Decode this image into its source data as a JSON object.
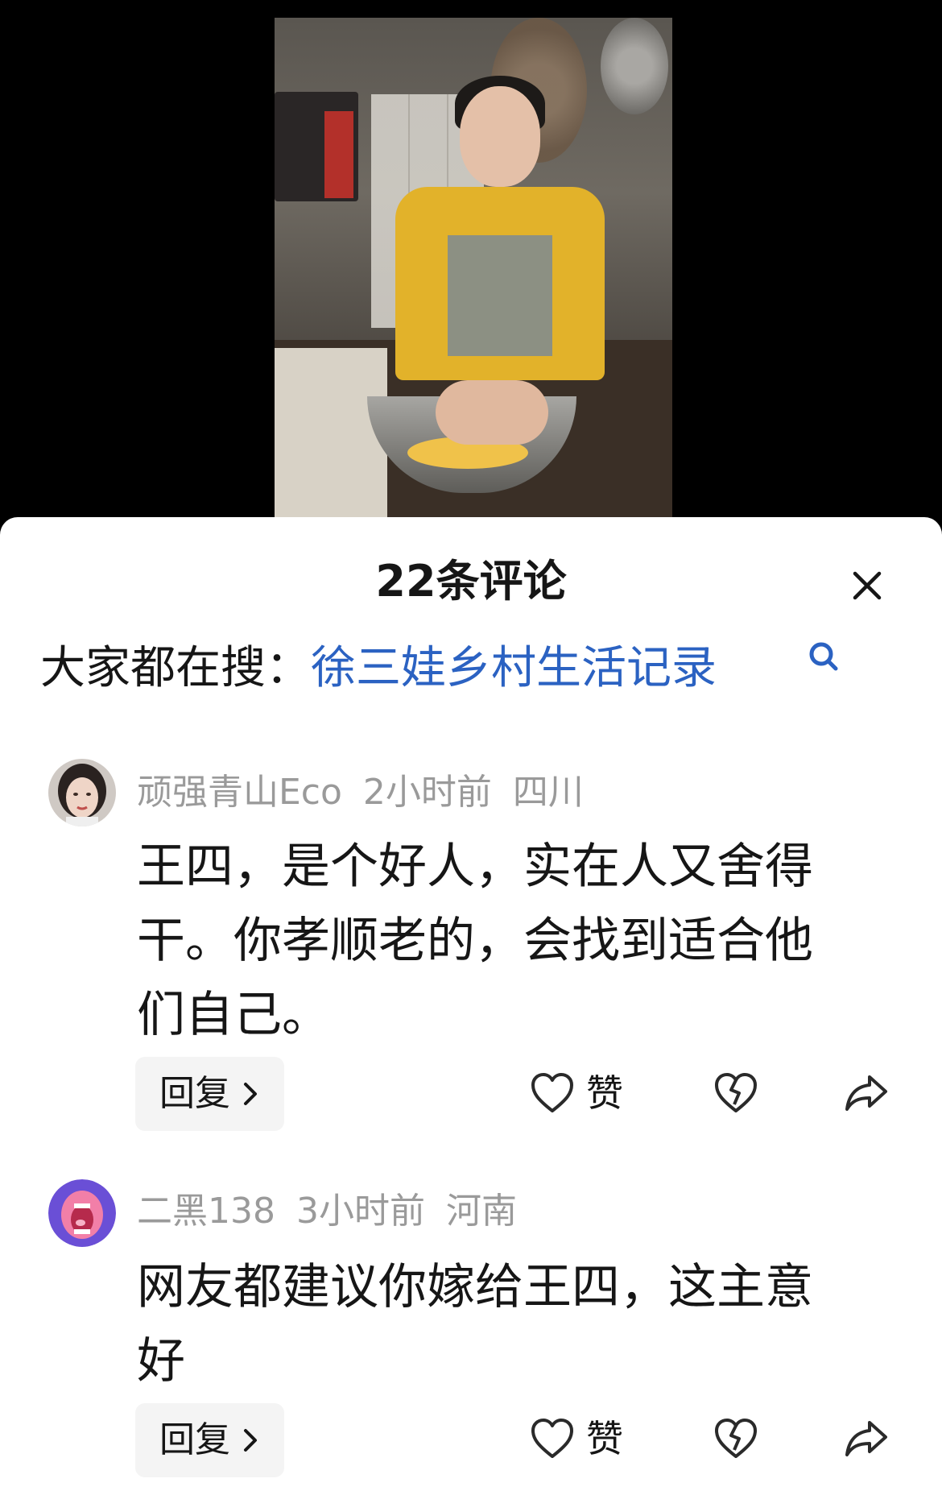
{
  "sheet": {
    "title": "22条评论",
    "search_prefix": "大家都在搜：",
    "search_term": "徐三娃乡村生活记录"
  },
  "comments": [
    {
      "username": "顽强青山Eco",
      "time": "2小时前",
      "location": "四川",
      "lines": [
        "王四，是个好人，实在人又舍得",
        "干。你孝顺老的，会找到适合他",
        "们自己。"
      ],
      "reply_label": "回复",
      "like_label": "赞"
    },
    {
      "username": "二黑138",
      "time": "3小时前",
      "location": "河南",
      "lines": [
        "网友都建议你嫁给王四，这主意",
        "好"
      ],
      "reply_label": "回复",
      "like_label": "赞"
    }
  ],
  "icons": {
    "close": "close-icon",
    "search": "search-icon",
    "like": "heart-outline-icon",
    "dislike": "broken-heart-icon",
    "share": "share-arrow-icon",
    "reply_chevron": "chevron-right-icon"
  },
  "colors": {
    "search_link": "#2b62c2",
    "meta_text": "#9a9a9a",
    "reply_bg": "#f4f4f4"
  }
}
